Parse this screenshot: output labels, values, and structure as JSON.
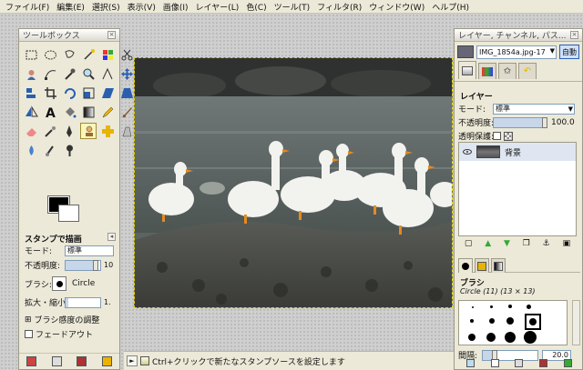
{
  "menubar": {
    "items": [
      "ファイル(F)",
      "編集(E)",
      "選択(S)",
      "表示(V)",
      "画像(I)",
      "レイヤー(L)",
      "色(C)",
      "ツール(T)",
      "フィルタ(R)",
      "ウィンドウ(W)",
      "ヘルプ(H)"
    ]
  },
  "toolbox": {
    "title": "ツールボックス",
    "close": "×",
    "options_title": "スタンプで描画",
    "mode_label": "モード:",
    "mode_value": "標準",
    "opacity_label": "不透明度:",
    "opacity_value": "10",
    "brush_label": "ブラシ:",
    "brush_value": "Circle",
    "scale_label": "拡大・縮小:",
    "scale_value": "1.",
    "dynamics_label": "ブラシ感度の調整",
    "fade_label": "フェードアウト",
    "expander": "⊞"
  },
  "status": {
    "message": "Ctrl+クリックで新たなスタンプソースを設定します",
    "arrow": "►"
  },
  "layers": {
    "title": "レイヤー, チャンネル, パス...",
    "close": "×",
    "image_name": "IMG_1854a.jpg-17",
    "auto_label": "自動",
    "section_title": "レイヤー",
    "mode_label": "モード:",
    "mode_value": "標準",
    "opacity_label": "不透明度:",
    "opacity_value": "100.0",
    "lock_label": "透明保護:",
    "layer_name": "背景"
  },
  "brushes": {
    "title": "ブラシ",
    "subtitle": "Circle (11) (13 × 13)",
    "spacing_label": "間隔:",
    "spacing_value": "20.0"
  },
  "colors": {
    "accent": "#316ac5",
    "selection": "#fff6b6",
    "panel": "#ece9d8"
  }
}
